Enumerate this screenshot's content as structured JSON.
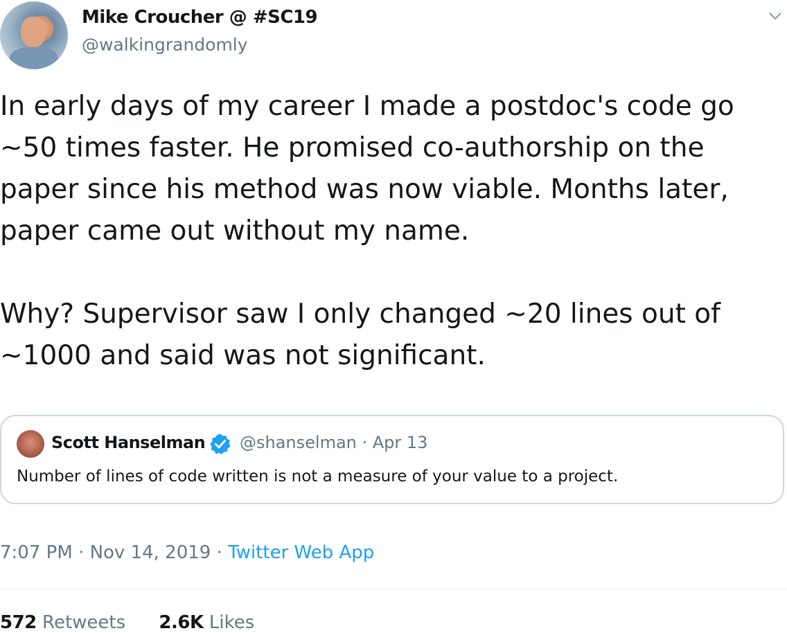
{
  "tweet": {
    "author": {
      "name": "Mike Croucher @ #SC19",
      "handle": "@walkingrandomly"
    },
    "body": {
      "paragraph1_lines": [
        "In early days of my career I made a postdoc's code go",
        "~50 times faster. He promised co-authorship on the",
        "paper since his method was now viable. Months later,",
        "paper came out without my name."
      ],
      "paragraph2_lines": [
        "Why? Supervisor saw I only changed ~20 lines out of",
        "~1000 and said was not significant."
      ]
    },
    "quoted_tweet": {
      "name": "Scott Hanselman",
      "handle": "@shanselman",
      "separator": " · ",
      "date": "Apr 13",
      "text": "Number of lines of code written is not a measure of your value to a project."
    },
    "meta": {
      "time": "7:07 PM",
      "separator": " · ",
      "date": "Nov 14, 2019",
      "separator2": " · ",
      "source": "Twitter Web App"
    },
    "stats": {
      "retweets_count": "572",
      "retweets_label": "Retweets",
      "likes_count": "2.6K",
      "likes_label": "Likes"
    }
  },
  "icons": {
    "caret": "chevron-down-icon",
    "verified": "verified-badge-icon"
  },
  "colors": {
    "text": "#14171a",
    "secondary": "#657786",
    "accent": "#1da1f2",
    "border": "#ccd6dd"
  }
}
